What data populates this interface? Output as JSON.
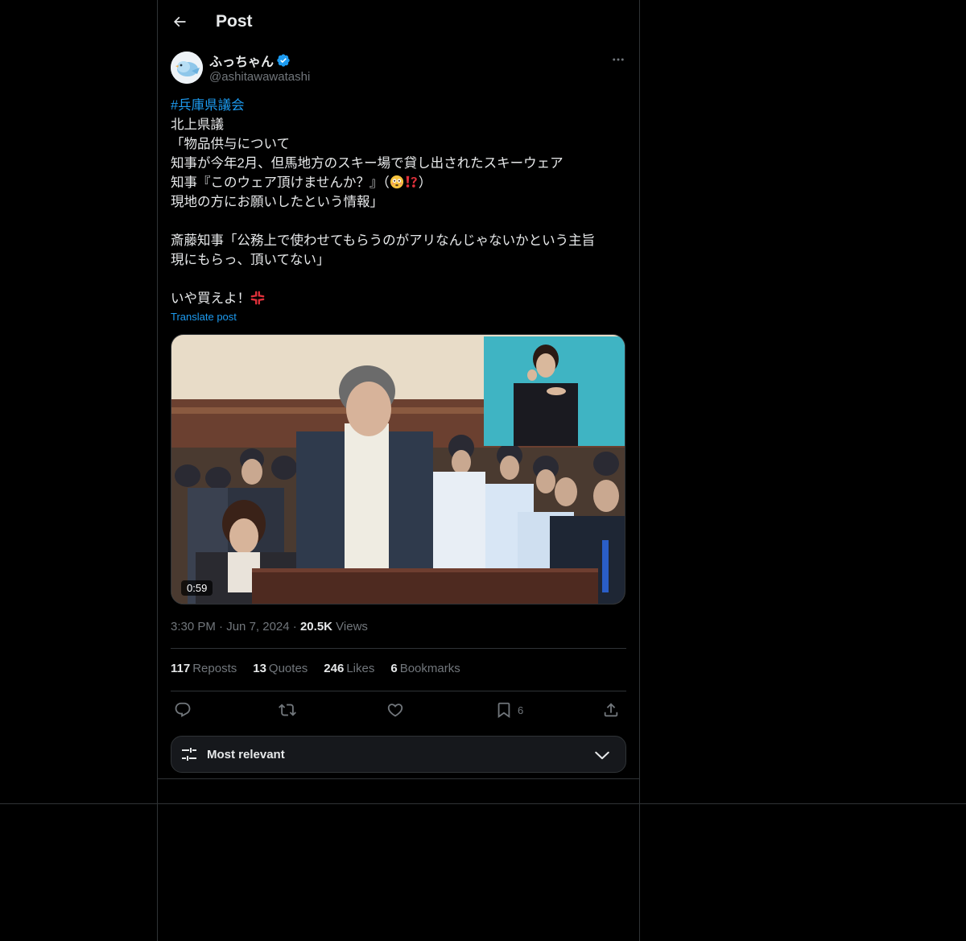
{
  "header": {
    "title": "Post"
  },
  "author": {
    "display_name": "ふっちゃん",
    "handle": "@ashitawawatashi"
  },
  "post": {
    "hashtag": "#兵庫県議会",
    "lines": [
      "北上県議",
      "「物品供与について",
      "知事が今年2月、但馬地方のスキー場で貸し出されたスキーウェア",
      "知事『このウェア頂けませんか？』（",
      "現地の方にお願いしたという情報」",
      "",
      "斎藤知事「公務上で使わせてもらうのがアリなんじゃないかという主旨",
      "現にもらっ、頂いてない」",
      "",
      "いや買えよ！"
    ],
    "line4_suffix": "）",
    "translate_label": "Translate post",
    "video_duration": "0:59"
  },
  "meta": {
    "time": "3:30 PM",
    "date": "Jun 7, 2024",
    "views_count": "20.5K",
    "views_label": "Views",
    "sep": "·"
  },
  "stats": {
    "reposts_count": "117",
    "reposts_label": "Reposts",
    "quotes_count": "13",
    "quotes_label": "Quotes",
    "likes_count": "246",
    "likes_label": "Likes",
    "bookmarks_count": "6",
    "bookmarks_label": "Bookmarks"
  },
  "actions": {
    "bookmark_count": "6"
  },
  "sort": {
    "label": "Most relevant"
  },
  "colors": {
    "accent": "#1d9bf0",
    "background": "#000000",
    "border": "#2f3336",
    "muted": "#71767b"
  }
}
